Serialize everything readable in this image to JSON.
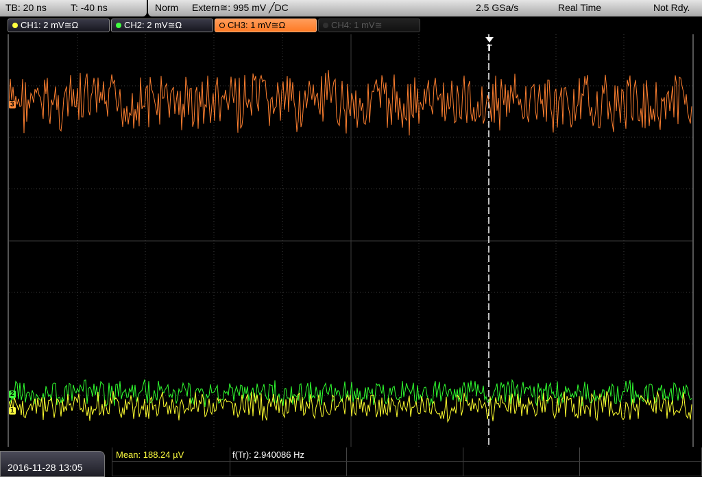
{
  "topbar": {
    "timebase": "TB: 20 ns",
    "trigger_time": "T: -40 ns",
    "mode": "Norm",
    "trigger": "Extern≅: 995 mV ╱DC",
    "sample_rate": "2.5 GSa/s",
    "acq_mode": "Real Time",
    "status": "Not Rdy."
  },
  "channels": [
    {
      "label": "CH1: 2 mV≅Ω",
      "color": "#ffff40",
      "state": "on"
    },
    {
      "label": "CH2: 2 mV≅Ω",
      "color": "#40ff40",
      "state": "on"
    },
    {
      "label": "CH3: 1 mV≅Ω",
      "color": "#ff8a3a",
      "state": "active"
    },
    {
      "label": "CH4: 1 mV≅",
      "color": "#505050",
      "state": "off"
    }
  ],
  "markers": {
    "ch3": "3",
    "ch2": "2",
    "ch1": "1",
    "trigger": "T"
  },
  "bottom": {
    "datetime": "2016-11-28 13:05",
    "mean": "Mean: 188.24 µV",
    "freq": "f(Tr): 2.940086 Hz"
  },
  "colors": {
    "ch1": "#ffff30",
    "ch2": "#30ff30",
    "ch3": "#ff8030",
    "grid": "#3c3c3c"
  }
}
